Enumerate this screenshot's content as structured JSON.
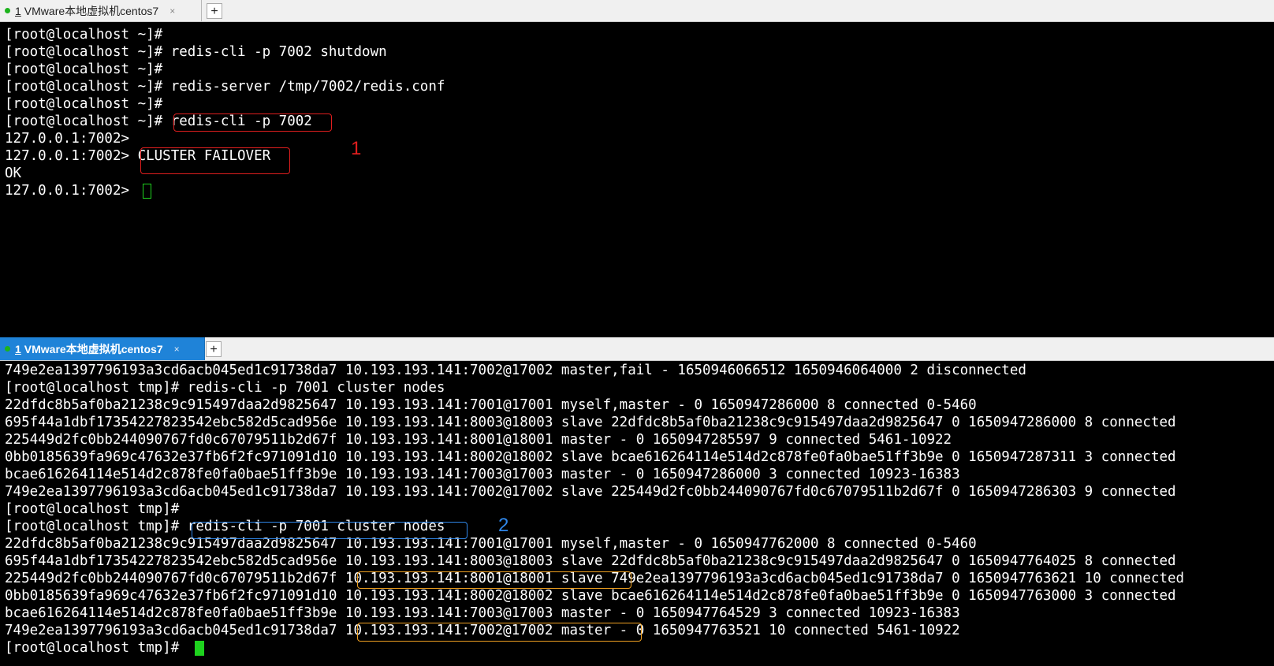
{
  "top_tab": {
    "number": "1",
    "title": "VMware本地虚拟机centos7",
    "close": "×"
  },
  "bottom_tab": {
    "number": "1",
    "title": "VMware本地虚拟机centos7",
    "close": "×"
  },
  "new_tab_label": "+",
  "top_lines": [
    "[root@localhost ~]#",
    "[root@localhost ~]# redis-cli -p 7002 shutdown",
    "[root@localhost ~]#",
    "[root@localhost ~]# redis-server /tmp/7002/redis.conf",
    "[root@localhost ~]#",
    "[root@localhost ~]# redis-cli -p 7002",
    "127.0.0.1:7002>",
    "127.0.0.1:7002> CLUSTER FAILOVER",
    "OK",
    "127.0.0.1:7002> "
  ],
  "bottom_lines": [
    "749e2ea1397796193a3cd6acb045ed1c91738da7 10.193.193.141:7002@17002 master,fail - 1650946066512 1650946064000 2 disconnected",
    "[root@localhost tmp]# redis-cli -p 7001 cluster nodes",
    "22dfdc8b5af0ba21238c9c915497daa2d9825647 10.193.193.141:7001@17001 myself,master - 0 1650947286000 8 connected 0-5460",
    "695f44a1dbf17354227823542ebc582d5cad956e 10.193.193.141:8003@18003 slave 22dfdc8b5af0ba21238c9c915497daa2d9825647 0 1650947286000 8 connected",
    "225449d2fc0bb244090767fd0c67079511b2d67f 10.193.193.141:8001@18001 master - 0 1650947285597 9 connected 5461-10922",
    "0bb0185639fa969c47632e37fb6f2fc971091d10 10.193.193.141:8002@18002 slave bcae616264114e514d2c878fe0fa0bae51ff3b9e 0 1650947287311 3 connected",
    "bcae616264114e514d2c878fe0fa0bae51ff3b9e 10.193.193.141:7003@17003 master - 0 1650947286000 3 connected 10923-16383",
    "749e2ea1397796193a3cd6acb045ed1c91738da7 10.193.193.141:7002@17002 slave 225449d2fc0bb244090767fd0c67079511b2d67f 0 1650947286303 9 connected",
    "[root@localhost tmp]#",
    "[root@localhost tmp]# redis-cli -p 7001 cluster nodes",
    "22dfdc8b5af0ba21238c9c915497daa2d9825647 10.193.193.141:7001@17001 myself,master - 0 1650947762000 8 connected 0-5460",
    "695f44a1dbf17354227823542ebc582d5cad956e 10.193.193.141:8003@18003 slave 22dfdc8b5af0ba21238c9c915497daa2d9825647 0 1650947764025 8 connected",
    "225449d2fc0bb244090767fd0c67079511b2d67f 10.193.193.141:8001@18001 slave 749e2ea1397796193a3cd6acb045ed1c91738da7 0 1650947763621 10 connected",
    "0bb0185639fa969c47632e37fb6f2fc971091d10 10.193.193.141:8002@18002 slave bcae616264114e514d2c878fe0fa0bae51ff3b9e 0 1650947763000 3 connected",
    "bcae616264114e514d2c878fe0fa0bae51ff3b9e 10.193.193.141:7003@17003 master - 0 1650947764529 3 connected 10923-16383",
    "749e2ea1397796193a3cd6acb045ed1c91738da7 10.193.193.141:7002@17002 master - 0 1650947763521 10 connected 5461-10922",
    "[root@localhost tmp]# "
  ],
  "annotations": {
    "first": "1",
    "second": "2"
  },
  "colors": {
    "red_highlight": "#e01e1e",
    "blue_highlight": "#2f86e8",
    "orange_highlight": "#f0a020",
    "cursor": "#1ed21e",
    "tab_dot": "#1db31d"
  }
}
